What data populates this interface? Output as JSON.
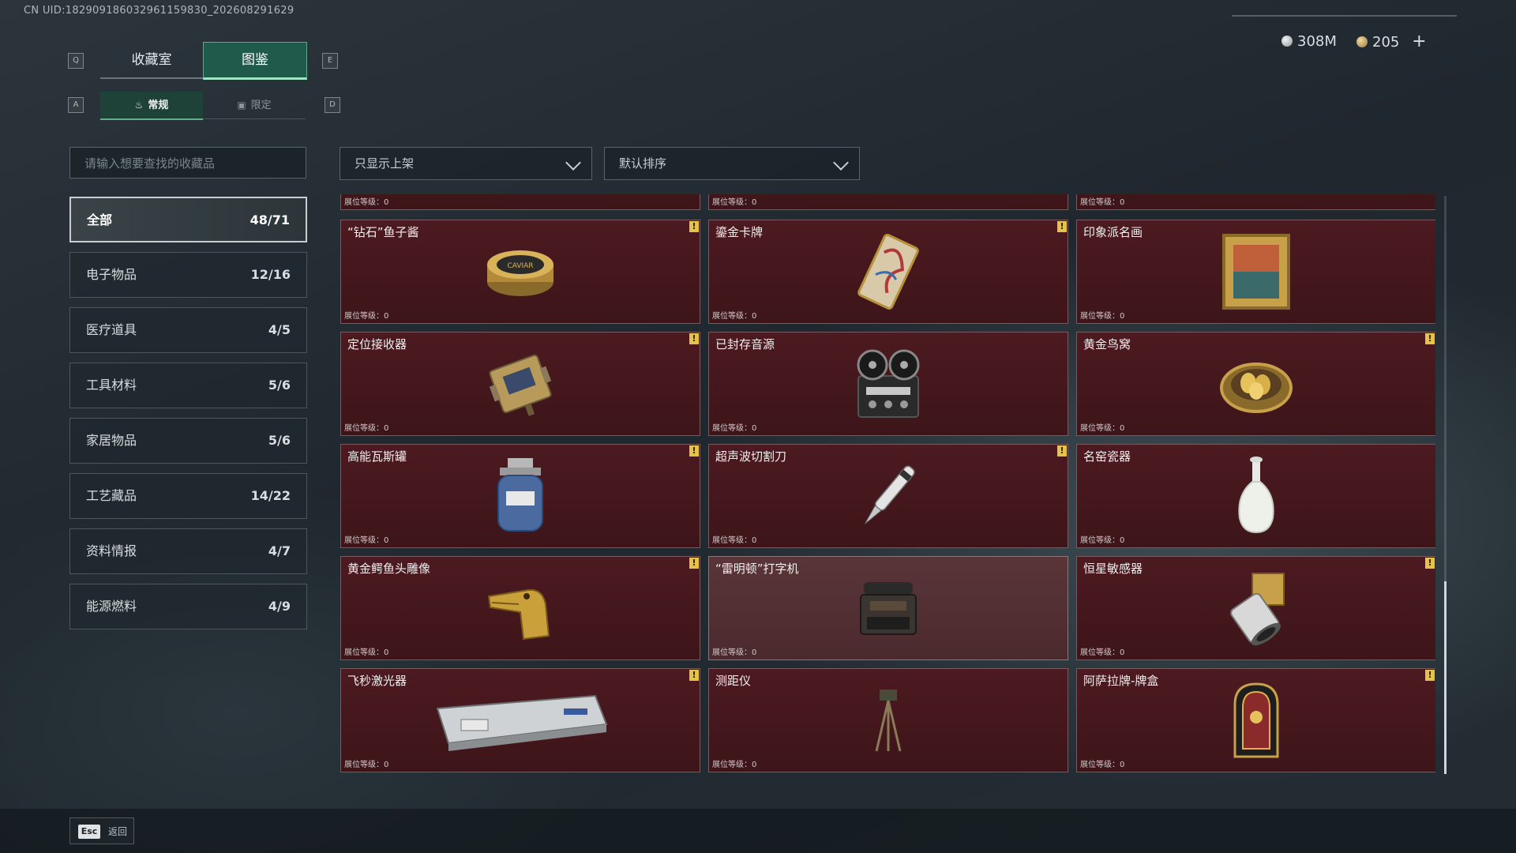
{
  "uid_text": "CN UID:1829091860329611598​30_202608291629",
  "tabs": {
    "collection": "收藏室",
    "atlas": "图鉴",
    "key_left": "Q",
    "key_right": "E"
  },
  "subtabs": {
    "normal": "常规",
    "limited": "限定",
    "key_left": "A",
    "key_right": "D"
  },
  "currency": {
    "silver": "308M",
    "gold": "205",
    "plus": "+"
  },
  "search": {
    "placeholder": "请输入想要查找的收藏品"
  },
  "filters": {
    "display": "只显示上架",
    "sort": "默认排序"
  },
  "categories": [
    {
      "label": "全部",
      "count": "48/71"
    },
    {
      "label": "电子物品",
      "count": "12/16"
    },
    {
      "label": "医疗道具",
      "count": "4/5"
    },
    {
      "label": "工具材料",
      "count": "5/6"
    },
    {
      "label": "家居物品",
      "count": "5/6"
    },
    {
      "label": "工艺藏品",
      "count": "14/22"
    },
    {
      "label": "资料情报",
      "count": "4/7"
    },
    {
      "label": "能源燃料",
      "count": "4/9"
    }
  ],
  "level_label": "展位等级：0",
  "items": [
    {
      "name": "“钻石”鱼子酱",
      "badge": "!"
    },
    {
      "name": "鎏金卡牌",
      "badge": "!"
    },
    {
      "name": "印象派名画",
      "badge": ""
    },
    {
      "name": "定位接收器",
      "badge": "!"
    },
    {
      "name": "已封存音源",
      "badge": ""
    },
    {
      "name": "黄金鸟窝",
      "badge": "!"
    },
    {
      "name": "高能瓦斯罐",
      "badge": "!"
    },
    {
      "name": "超声波切割刀",
      "badge": "!"
    },
    {
      "name": "名窑瓷器",
      "badge": ""
    },
    {
      "name": "黄金鳄鱼头雕像",
      "badge": "!"
    },
    {
      "name": "“雷明顿”打字机",
      "badge": ""
    },
    {
      "name": "恒星敏感器",
      "badge": "!"
    },
    {
      "name": "飞秒激光器",
      "badge": "!"
    },
    {
      "name": "测距仪",
      "badge": ""
    },
    {
      "name": "阿萨拉牌-牌盒",
      "badge": "!"
    }
  ],
  "footer": {
    "key": "Esc",
    "label": "返回"
  }
}
